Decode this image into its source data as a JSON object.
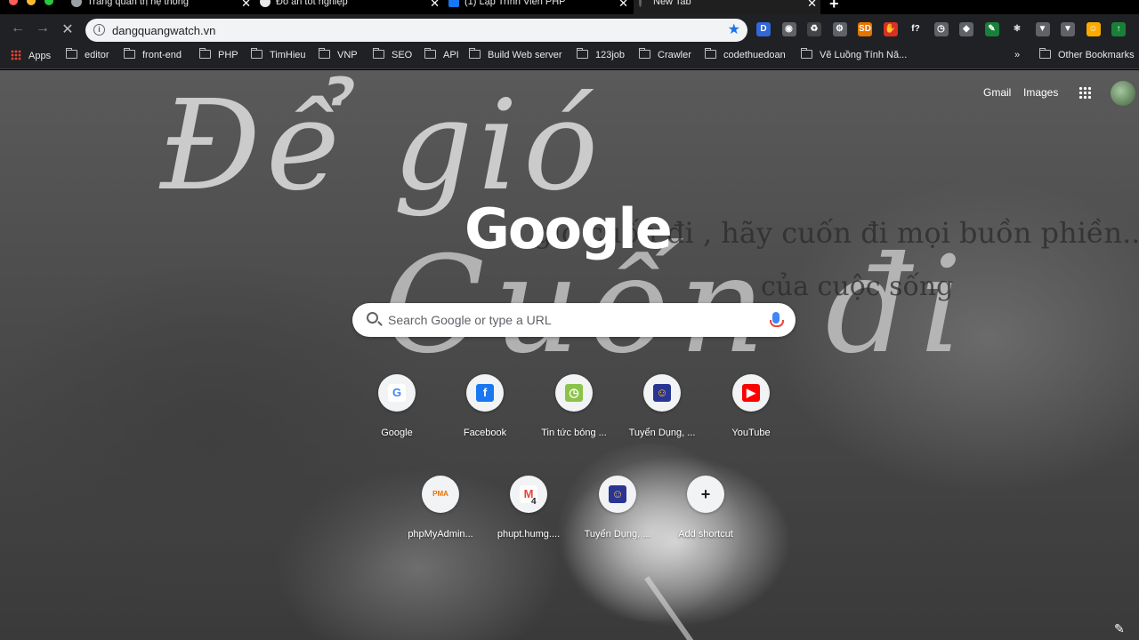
{
  "tabs": [
    {
      "title": "Trang quản trị hệ thống",
      "favicon": "globe-icon",
      "color": "#9aa0a6"
    },
    {
      "title": "Đồ án tốt nghiệp",
      "favicon": "globe-icon",
      "color": "#e8e8e8"
    },
    {
      "title": "(1) Lập Trình Viên PHP",
      "favicon": "facebook-icon",
      "color": "#1877f2"
    },
    {
      "title": "New Tab",
      "favicon": "newtab-icon",
      "color": "#5f6368"
    }
  ],
  "toolbar": {
    "url": "dangquangwatch.vn",
    "back": "←",
    "forward": "→",
    "reload": "✕"
  },
  "extensions": [
    {
      "icon": "d-extension-icon",
      "text": "D",
      "color": "#3367d6"
    },
    {
      "icon": "camera-icon",
      "text": "◉",
      "color": "#5f6368"
    },
    {
      "icon": "recycle-icon",
      "text": "♻",
      "color": "#444"
    },
    {
      "icon": "gear-icon",
      "text": "⚙",
      "color": "#5f6368"
    },
    {
      "icon": "sd-extension-icon",
      "text": "SD",
      "color": "#e37400"
    },
    {
      "icon": "hand-icon",
      "text": "✋",
      "color": "#d93025"
    },
    {
      "icon": "formula-icon",
      "text": "f?",
      "color": "#202124"
    },
    {
      "icon": "timer-icon",
      "text": "◷",
      "color": "#5f6368"
    },
    {
      "icon": "layers-icon",
      "text": "◆",
      "color": "#5f6368"
    },
    {
      "icon": "pen-icon",
      "text": "✎",
      "color": "#188038"
    },
    {
      "icon": "react-icon",
      "text": "⚛",
      "color": "#202124"
    },
    {
      "icon": "vue-icon",
      "text": "▼",
      "color": "#5f6368"
    },
    {
      "icon": "dropdown-icon",
      "text": "▼",
      "color": "#5f6368"
    },
    {
      "icon": "profile-icon",
      "text": "☺",
      "color": "#f9ab00"
    },
    {
      "icon": "update-icon",
      "text": "↑",
      "color": "#188038"
    }
  ],
  "bookmarks": [
    {
      "label": "Apps",
      "type": "apps"
    },
    {
      "label": "editor",
      "type": "folder"
    },
    {
      "label": "front-end",
      "type": "folder"
    },
    {
      "label": "PHP",
      "type": "folder"
    },
    {
      "label": "TimHieu",
      "type": "folder"
    },
    {
      "label": "VNP",
      "type": "folder"
    },
    {
      "label": "SEO",
      "type": "folder"
    },
    {
      "label": "API",
      "type": "folder"
    },
    {
      "label": "Build Web server",
      "type": "folder"
    },
    {
      "label": "123job",
      "type": "folder"
    },
    {
      "label": "Crawler",
      "type": "folder"
    },
    {
      "label": "codethuedoan",
      "type": "folder"
    },
    {
      "label": "Vẽ Luồng Tính Nă...",
      "type": "folder"
    }
  ],
  "bookmarks_more": "»",
  "other_bookmarks": "Other Bookmarks",
  "background": {
    "line1": "Để gió",
    "line2": "Cuốn đi",
    "small1": "gió cuốn đi , hãy cuốn đi mọi buồn phiền...",
    "small2": "của cuộc sống"
  },
  "header": {
    "gmail": "Gmail",
    "images": "Images"
  },
  "logo": "Google",
  "search": {
    "placeholder": "Search Google or type a URL"
  },
  "shortcuts": [
    {
      "label": "Google",
      "icon": "google-icon",
      "glyph": "G",
      "bg": "#ffffff",
      "fg": "#4285f4"
    },
    {
      "label": "Facebook",
      "icon": "facebook-icon",
      "glyph": "f",
      "bg": "#1877f2",
      "fg": "#ffffff"
    },
    {
      "label": "Tin tức bóng ...",
      "icon": "clock-icon",
      "glyph": "◷",
      "bg": "#8bc34a",
      "fg": "#ffffff"
    },
    {
      "label": "Tuyển Dụng, ...",
      "icon": "job-icon",
      "glyph": "☺",
      "bg": "#283593",
      "fg": "#fbc02d"
    },
    {
      "label": "YouTube",
      "icon": "youtube-icon",
      "glyph": "▶",
      "bg": "#ff0000",
      "fg": "#ffffff"
    },
    {
      "label": "phpMyAdmin...",
      "icon": "phpmyadmin-icon",
      "glyph": "PMA",
      "bg": "#f1f3f4",
      "fg": "#e8710a"
    },
    {
      "label": "phupt.humg....",
      "icon": "gmail-icon",
      "glyph": "M",
      "bg": "#ffffff",
      "fg": "#ea4335"
    },
    {
      "label": "Tuyển Dụng, ...",
      "icon": "job-icon",
      "glyph": "☺",
      "bg": "#283593",
      "fg": "#fbc02d"
    },
    {
      "label": "Add shortcut",
      "icon": "plus-icon",
      "glyph": "+",
      "bg": "transparent",
      "fg": "#202124"
    }
  ],
  "gmail_badge": "4"
}
